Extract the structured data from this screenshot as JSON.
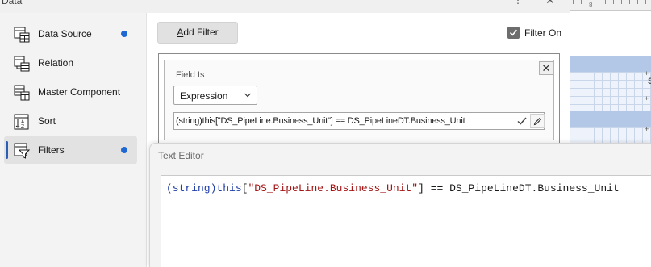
{
  "window": {
    "title": "Data",
    "more_glyph": "⋮",
    "close_glyph": "✕"
  },
  "sidebar": {
    "items": [
      {
        "label": "Data Source",
        "icon": "data-source-icon",
        "dot": true,
        "active": false
      },
      {
        "label": "Relation",
        "icon": "relation-icon",
        "dot": false,
        "active": false
      },
      {
        "label": "Master Component",
        "icon": "master-component-icon",
        "dot": false,
        "active": false
      },
      {
        "label": "Sort",
        "icon": "sort-icon",
        "dot": false,
        "active": false
      },
      {
        "label": "Filters",
        "icon": "filter-icon",
        "dot": true,
        "active": true
      }
    ]
  },
  "toolbar": {
    "add_filter_accel": "A",
    "add_filter_rest": "dd Filter",
    "filter_on_label": "Filter On",
    "filter_on_checked": true
  },
  "filter": {
    "field_label": "Field Is",
    "type_value": "Expression",
    "expression": "(string)this[\"DS_PipeLine.Business_Unit\"] == DS_PipeLineDT.Business_Unit",
    "close_glyph": "✕"
  },
  "text_editor": {
    "title": "Text Editor",
    "code_tokens": {
      "cast": "(string)",
      "this_kw": "this",
      "open": "[",
      "string": "\"DS_PipeLine.Business_Unit\"",
      "rest": "] == DS_PipeLineDT.Business_Unit"
    }
  },
  "designer": {
    "ruler_number": "8",
    "band_marker": "+",
    "side_letter": "S"
  },
  "colors": {
    "accent": "#1f67d2",
    "selection_band": "#b3c8e6",
    "keyword": "#1f3ea6",
    "string": "#a31515"
  }
}
